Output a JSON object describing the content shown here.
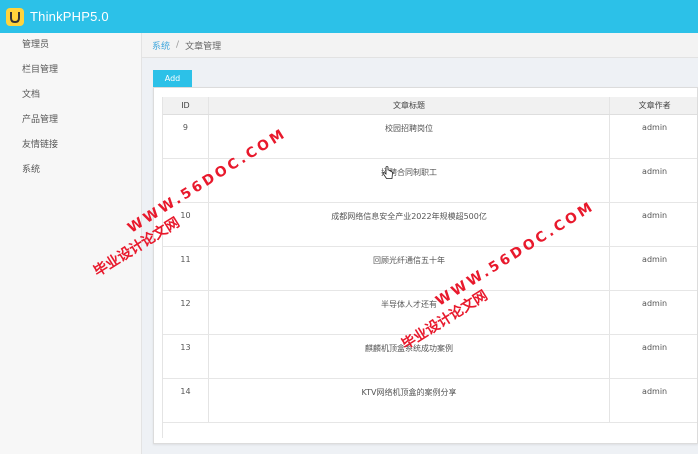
{
  "app": {
    "title": "ThinkPHP5.0",
    "logo_icon": "smile-logo-icon",
    "brand_color": "#2cc1e8",
    "logo_color": "#ffd43b"
  },
  "sidebar": {
    "items": [
      "管理员",
      "栏目管理",
      "文档",
      "产品管理",
      "友情链接",
      "系统"
    ]
  },
  "breadcrumb": {
    "parent": "系统",
    "separator": "/",
    "current": "文章管理"
  },
  "toolbar": {
    "add_label": "Add"
  },
  "table": {
    "headers": [
      "ID",
      "文章标题",
      "文章作者"
    ],
    "rows": [
      [
        "9",
        "校园招聘岗位",
        "admin"
      ],
      [
        "",
        "招聘合同制职工",
        "admin"
      ],
      [
        "10",
        "成都网络信息安全产业2022年规模超500亿",
        "admin"
      ],
      [
        "11",
        "回顾光纤通信五十年",
        "admin"
      ],
      [
        "12",
        "半导体人才还有",
        "admin"
      ],
      [
        "13",
        "麒麟机顶盒系统成功案例",
        "admin"
      ],
      [
        "14",
        "KTV网络机顶盒的案例分享",
        "admin"
      ]
    ]
  },
  "watermarks": [
    {
      "cn": "毕业设计论文网",
      "url": "WWW.56DOC.COM"
    },
    {
      "cn": "毕业设计论文网",
      "url": "WWW.56DOC.COM"
    }
  ],
  "watermark_color": "#e8192c"
}
